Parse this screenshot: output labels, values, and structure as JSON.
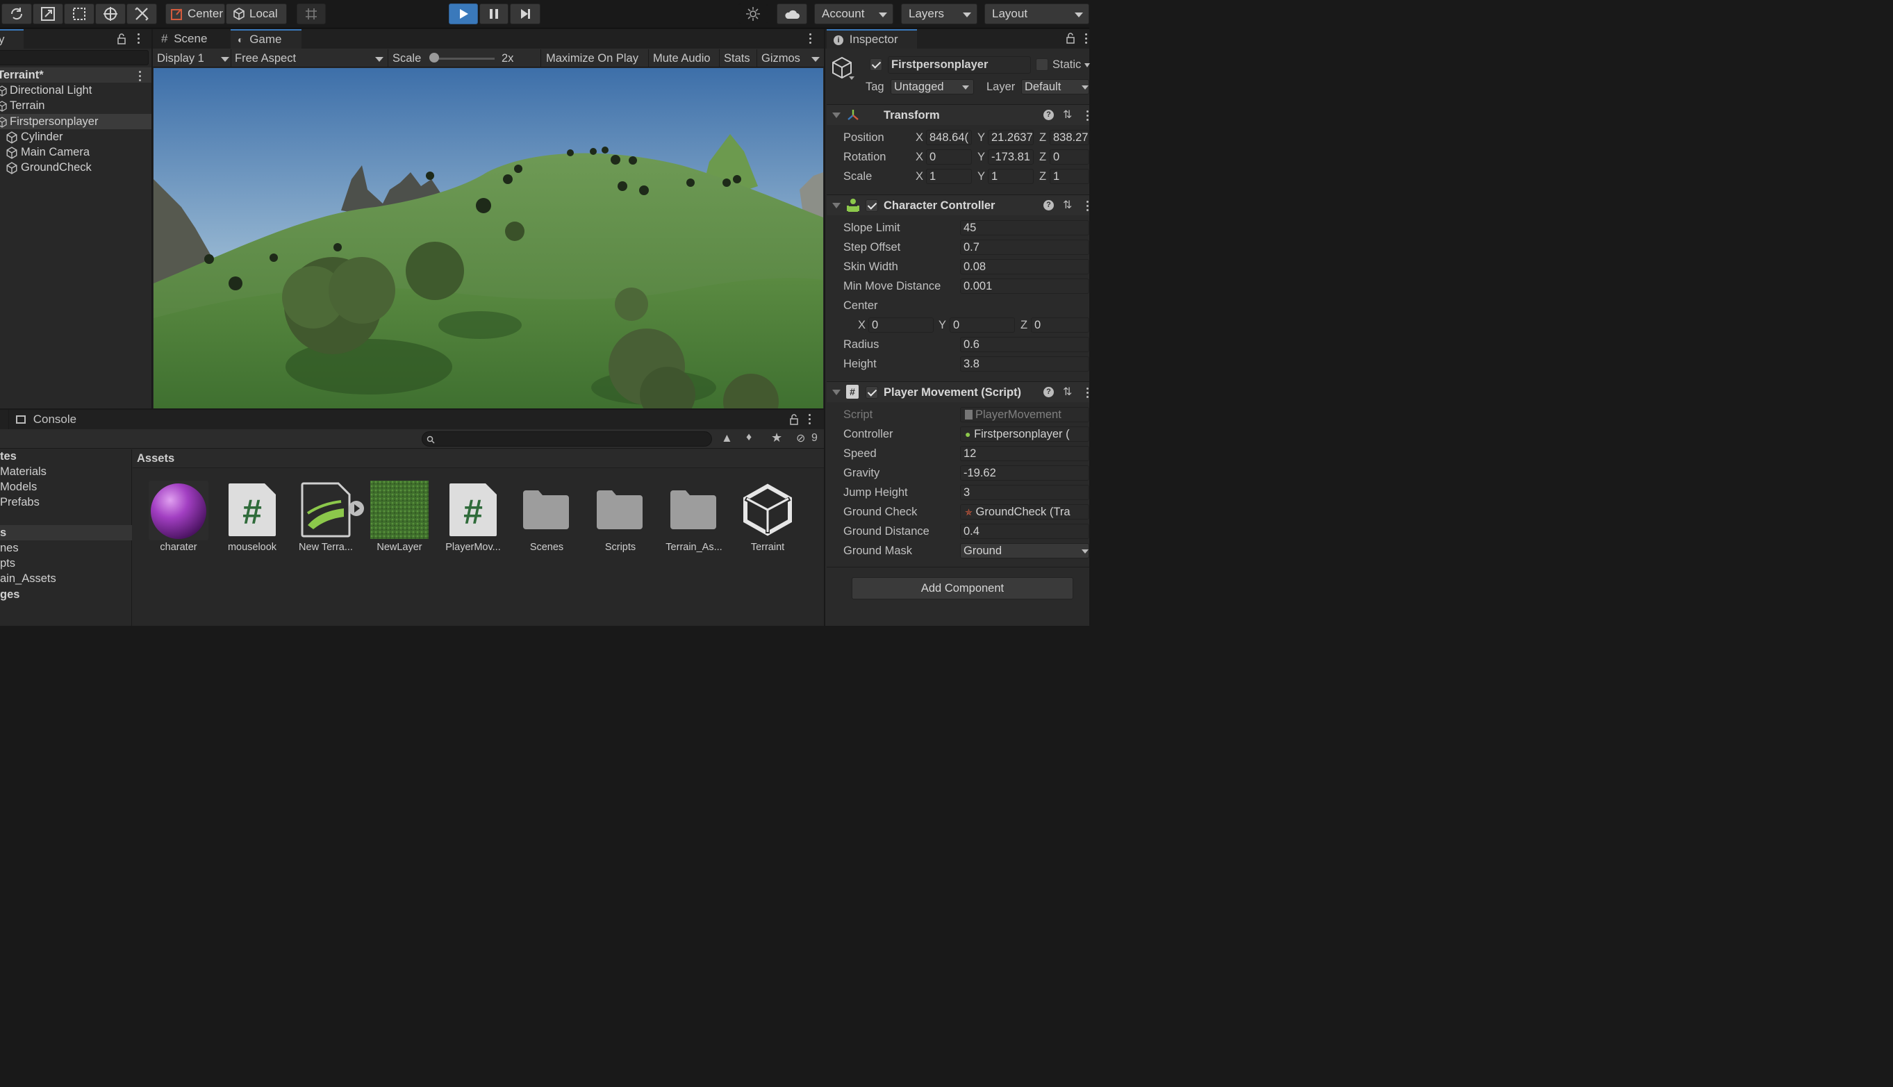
{
  "toolbar": {
    "pivot_label": "Center",
    "space_label": "Local",
    "account_label": "Account",
    "layers_label": "Layers",
    "layout_label": "Layout",
    "play_accent": "#3a79bb"
  },
  "hierarchy": {
    "tab_label": "y",
    "scene_name": "Terraint*",
    "items": [
      {
        "label": "Directional Light"
      },
      {
        "label": "Terrain"
      },
      {
        "label": "Firstpersonplayer"
      },
      {
        "label": "Cylinder"
      },
      {
        "label": "Main Camera"
      },
      {
        "label": "GroundCheck"
      }
    ]
  },
  "view": {
    "tab_scene": "Scene",
    "tab_game": "Game",
    "display": "Display 1",
    "aspect": "Free Aspect",
    "scale_label": "Scale",
    "scale_value": "2x",
    "maximize": "Maximize On Play",
    "mute": "Mute Audio",
    "stats": "Stats",
    "gizmos": "Gizmos"
  },
  "inspector": {
    "tab_label": "Inspector",
    "object_name": "Firstpersonplayer",
    "static_label": "Static",
    "tag_label": "Tag",
    "tag_value": "Untagged",
    "layer_label": "Layer",
    "layer_value": "Default",
    "transform": {
      "title": "Transform",
      "position_label": "Position",
      "rotation_label": "Rotation",
      "scale_label": "Scale",
      "position": {
        "x": "848.64(",
        "y": "21.2637",
        "z": "838.27"
      },
      "rotation": {
        "x": "0",
        "y": "-173.81",
        "z": "0"
      },
      "scale": {
        "x": "1",
        "y": "1",
        "z": "1"
      },
      "axis_x": "X",
      "axis_y": "Y",
      "axis_z": "Z"
    },
    "character_controller": {
      "title": "Character Controller",
      "slope_limit_label": "Slope Limit",
      "slope_limit": "45",
      "step_offset_label": "Step Offset",
      "step_offset": "0.7",
      "skin_width_label": "Skin Width",
      "skin_width": "0.08",
      "min_move_label": "Min Move Distance",
      "min_move": "0.001",
      "center_label": "Center",
      "center": {
        "x": "0",
        "y": "0",
        "z": "0"
      },
      "radius_label": "Radius",
      "radius": "0.6",
      "height_label": "Height",
      "height": "3.8"
    },
    "player_movement": {
      "title": "Player Movement (Script)",
      "script_label": "Script",
      "script": "PlayerMovement",
      "controller_label": "Controller",
      "controller": "Firstpersonplayer (",
      "speed_label": "Speed",
      "speed": "12",
      "gravity_label": "Gravity",
      "gravity": "-19.62",
      "jump_label": "Jump Height",
      "jump": "3",
      "ground_check_label": "Ground Check",
      "ground_check": "GroundCheck (Tra",
      "ground_distance_label": "Ground Distance",
      "ground_distance": "0.4",
      "ground_mask_label": "Ground Mask",
      "ground_mask": "Ground"
    },
    "add_component": "Add Component"
  },
  "console": {
    "tab_label": "Console",
    "hidden_count": "9"
  },
  "project": {
    "left_items": [
      {
        "label": "tes",
        "bold": true
      },
      {
        "label": "Materials",
        "bold": false
      },
      {
        "label": "Models",
        "bold": false
      },
      {
        "label": "Prefabs",
        "bold": false
      },
      {
        "label": "s",
        "bold": true
      },
      {
        "label": "nes",
        "bold": false
      },
      {
        "label": "pts",
        "bold": false
      },
      {
        "label": "ain_Assets",
        "bold": false
      },
      {
        "label": "ges",
        "bold": true
      }
    ],
    "breadcrumb": "Assets",
    "assets": [
      {
        "label": "charater",
        "icon": "material-sphere-icon"
      },
      {
        "label": "mouselook",
        "icon": "csharp-script-icon"
      },
      {
        "label": "New Terra...",
        "icon": "terrain-data-icon"
      },
      {
        "label": "NewLayer",
        "icon": "terrain-layer-icon"
      },
      {
        "label": "PlayerMov...",
        "icon": "csharp-script-icon"
      },
      {
        "label": "Scenes",
        "icon": "folder-icon"
      },
      {
        "label": "Scripts",
        "icon": "folder-icon"
      },
      {
        "label": "Terrain_As...",
        "icon": "folder-icon"
      },
      {
        "label": "Terraint",
        "icon": "unity-scene-icon"
      }
    ]
  }
}
